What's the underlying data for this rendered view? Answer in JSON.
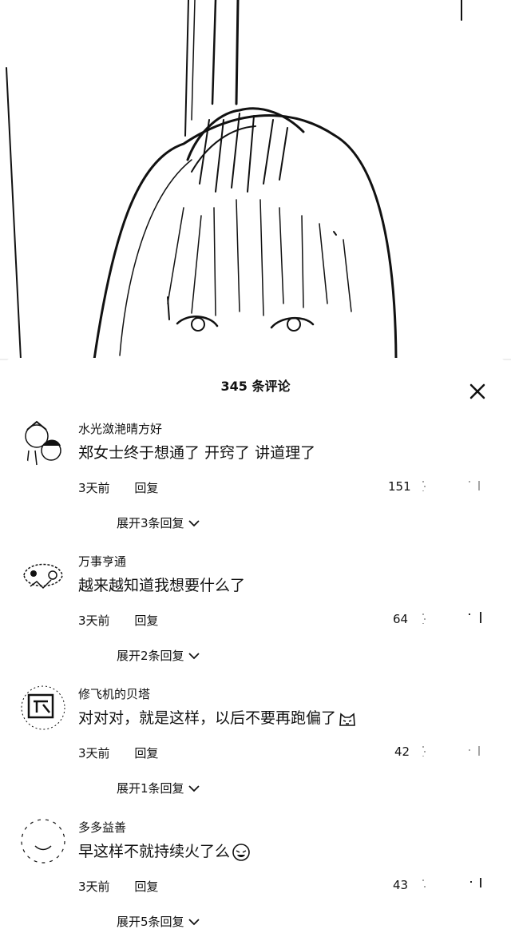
{
  "sheet": {
    "comment_count_title": "345 条评论"
  },
  "comments": [
    {
      "username": "水光潋滟晴方好",
      "text": "郑女士终于想通了 开窍了 讲道理了",
      "time": "3天前",
      "reply_label": "回复",
      "likes": "151",
      "expand_label": "展开3条回复"
    },
    {
      "username": "万事亨通",
      "text": "越来越知道我想要什么了",
      "time": "3天前",
      "reply_label": "回复",
      "likes": "64",
      "expand_label": "展开2条回复"
    },
    {
      "username": "修飞机的贝塔",
      "text": "对对对，就是这样，以后不要再跑偏了",
      "time": "3天前",
      "reply_label": "回复",
      "likes": "42",
      "expand_label": "展开1条回复"
    },
    {
      "username": "多多益善",
      "text": "早这样不就持续火了么",
      "time": "3天前",
      "reply_label": "回复",
      "likes": "43",
      "expand_label": "展开5条回复"
    }
  ]
}
